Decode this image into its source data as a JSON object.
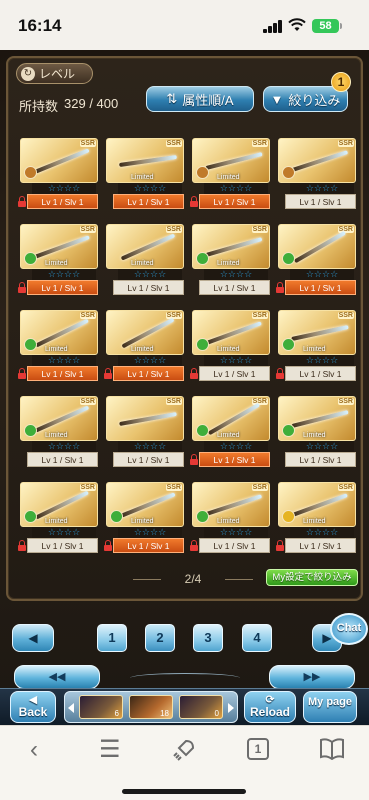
{
  "status": {
    "time": "16:14",
    "battery": "58"
  },
  "header": {
    "level_label": "レベル",
    "owned_label": "所持数",
    "owned_value": "329 / 400",
    "sort_label": "属性順/A",
    "filter_label": "絞り込み",
    "filter_badge": "1"
  },
  "cards": [
    {
      "limited": "",
      "stars": "☆☆☆☆",
      "lv": "Lv 1 / Slv 1",
      "elem": "#c07a2a",
      "locked": true,
      "orange": true
    },
    {
      "limited": "Limited",
      "stars": "☆☆☆☆",
      "lv": "Lv 1 / Slv 1",
      "elem": "",
      "locked": false,
      "orange": true
    },
    {
      "limited": "Limited",
      "stars": "☆☆☆☆",
      "lv": "Lv 1 / Slv 1",
      "elem": "#c07a2a",
      "locked": true,
      "orange": true
    },
    {
      "limited": "",
      "stars": "☆☆☆☆",
      "lv": "Lv 1 / Slv 1",
      "elem": "#c07a2a",
      "locked": false,
      "orange": false
    },
    {
      "limited": "Limited",
      "stars": "☆☆☆☆",
      "lv": "Lv 1 / Slv 1",
      "elem": "#3fae3a",
      "locked": true,
      "orange": true
    },
    {
      "limited": "Limited",
      "stars": "☆☆☆☆",
      "lv": "Lv 1 / Slv 1",
      "elem": "",
      "locked": false,
      "orange": false
    },
    {
      "limited": "Limited",
      "stars": "☆☆☆☆",
      "lv": "Lv 1 / Slv 1",
      "elem": "#3fae3a",
      "locked": false,
      "orange": false
    },
    {
      "limited": "",
      "stars": "☆☆☆☆",
      "lv": "Lv 1 / Slv 1",
      "elem": "#3fae3a",
      "locked": true,
      "orange": true
    },
    {
      "limited": "Limited",
      "stars": "☆☆☆☆",
      "lv": "Lv 1 / Slv 1",
      "elem": "#3fae3a",
      "locked": true,
      "orange": true
    },
    {
      "limited": "Limited",
      "stars": "☆☆☆☆",
      "lv": "Lv 1 / Slv 1",
      "elem": "",
      "locked": true,
      "orange": true
    },
    {
      "limited": "Limited",
      "stars": "☆☆☆☆",
      "lv": "Lv 1 / Slv 1",
      "elem": "#3fae3a",
      "locked": true,
      "orange": false
    },
    {
      "limited": "Limited",
      "stars": "☆☆☆☆",
      "lv": "Lv 1 / Slv 1",
      "elem": "#3fae3a",
      "locked": true,
      "orange": false
    },
    {
      "limited": "Limited",
      "stars": "☆☆☆☆",
      "lv": "Lv 1 / Slv 1",
      "elem": "#3fae3a",
      "locked": false,
      "orange": false
    },
    {
      "limited": "",
      "stars": "☆☆☆☆",
      "lv": "Lv 1 / Slv 1",
      "elem": "",
      "locked": false,
      "orange": false
    },
    {
      "limited": "Limited",
      "stars": "☆☆☆☆",
      "lv": "Lv 1 / Slv 1",
      "elem": "#3fae3a",
      "locked": true,
      "orange": true
    },
    {
      "limited": "Limited",
      "stars": "☆☆☆☆",
      "lv": "Lv 1 / Slv 1",
      "elem": "#3fae3a",
      "locked": false,
      "orange": false
    },
    {
      "limited": "Limited",
      "stars": "☆☆☆☆",
      "lv": "Lv 1 / Slv 1",
      "elem": "#3fae3a",
      "locked": true,
      "orange": false
    },
    {
      "limited": "Limited",
      "stars": "☆☆☆☆",
      "lv": "Lv 1 / Slv 1",
      "elem": "#3fae3a",
      "locked": true,
      "orange": true
    },
    {
      "limited": "Limited",
      "stars": "☆☆☆☆",
      "lv": "Lv 1 / Slv 1",
      "elem": "#3fae3a",
      "locked": true,
      "orange": false
    },
    {
      "limited": "Limited",
      "stars": "☆☆☆☆",
      "lv": "Lv 1 / Slv 1",
      "elem": "#e6b422",
      "locked": true,
      "orange": false
    }
  ],
  "pagination": {
    "indicator": "2/4",
    "my_settings": "My設定で絞り込み",
    "pages": [
      "1",
      "2",
      "3",
      "4"
    ],
    "prev": "◀",
    "next": "▶",
    "first": "◀◀",
    "last": "▶▶"
  },
  "chat_label": "Chat",
  "nav": {
    "back": "Back",
    "reload": "Reload",
    "mypage": "My page",
    "party_slots": [
      "6",
      "18",
      "0"
    ]
  },
  "browser": {
    "tab_count": "1"
  }
}
